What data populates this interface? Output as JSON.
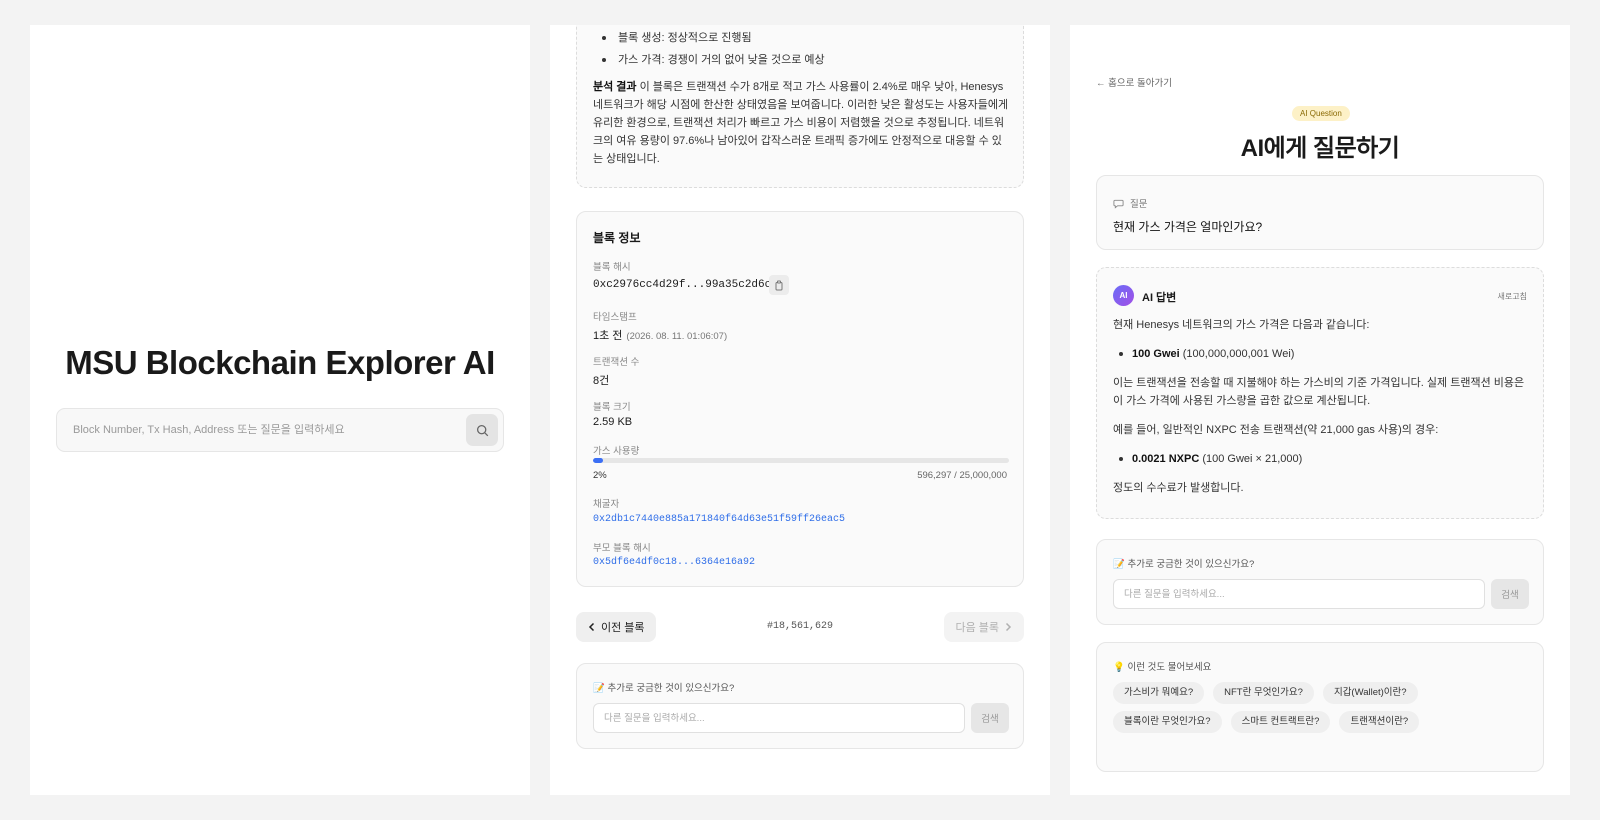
{
  "home": {
    "title": "MSU Blockchain Explorer AI",
    "search_placeholder": "Block Number, Tx Hash, Address 또는 질문을 입력하세요"
  },
  "block_page": {
    "analysis": {
      "bullets": [
        "블록 생성: 정상적으로 진행됨",
        "가스 가격: 경쟁이 거의 없어 낮을 것으로 예상"
      ],
      "result_label": "분석 결과",
      "result_text": " 이 블록은 트랜잭션 수가 8개로 적고 가스 사용률이 2.4%로 매우 낮아, Henesys 네트워크가 해당 시점에 한산한 상태였음을 보여줍니다. 이러한 낮은 활성도는 사용자들에게 유리한 환경으로, 트랜잭션 처리가 빠르고 가스 비용이 저렴했을 것으로 추정됩니다. 네트워크의 여유 용량이 97.6%나 남아있어 갑작스러운 트래픽 증가에도 안정적으로 대응할 수 있는 상태입니다."
    },
    "info": {
      "title": "블록 정보",
      "hash_label": "블록 해시",
      "hash_value": "0xc2976cc4d29f...99a35c2d6c",
      "timestamp_label": "타임스탬프",
      "timestamp_relative": "1초 전",
      "timestamp_absolute": "(2026. 08. 11. 01:06:07)",
      "tx_count_label": "트랜잭션 수",
      "tx_count_value": "8건",
      "size_label": "블록 크기",
      "size_value": "2.59 KB",
      "gas_label": "가스 사용량",
      "gas_percent_text": "2%",
      "gas_fraction": 0.024,
      "gas_detail": "596,297 / 25,000,000",
      "miner_label": "채굴자",
      "miner_value": "0x2db1c7440e885a171840f64d63e51f59ff26eac5",
      "parent_label": "부모 블록 해시",
      "parent_value": "0x5df6e4df0c18...6364e16a92"
    },
    "nav": {
      "prev_label": "이전 블록",
      "block_number": "#18,561,629",
      "next_label": "다음 블록"
    },
    "ask": {
      "label": "📝 추가로 궁금한 것이 있으신가요?",
      "placeholder": "다른 질문을 입력하세요...",
      "button": "검색"
    }
  },
  "ai_page": {
    "back_link": "← 홈으로 돌아가기",
    "badge": "AI Question",
    "title": "AI에게 질문하기",
    "question_label": "질문",
    "question_text": "현재 가스 가격은 얼마인가요?",
    "answer_title": "AI 답변",
    "avatar_text": "AI",
    "refresh_label": "새로고침",
    "answer": {
      "intro": "현재 Henesys 네트워크의 가스 가격은 다음과 같습니다:",
      "b1_bold": "100 Gwei",
      "b1_rest": " (100,000,000,001 Wei)",
      "para2": "이는 트랜잭션을 전송할 때 지불해야 하는 가스비의 기준 가격입니다. 실제 트랜잭션 비용은 이 가스 가격에 사용된 가스량을 곱한 값으로 계산됩니다.",
      "para3": "예를 들어, 일반적인 NXPC 전송 트랜잭션(약 21,000 gas 사용)의 경우:",
      "b2_bold": "0.0021 NXPC",
      "b2_rest": " (100 Gwei × 21,000)",
      "outro": "정도의 수수료가 발생합니다."
    },
    "ask": {
      "label": "📝 추가로 궁금한 것이 있으신가요?",
      "placeholder": "다른 질문을 입력하세요...",
      "button": "검색"
    },
    "suggest_label": "💡 이런 것도 물어보세요",
    "suggestions": [
      "가스비가 뭐예요?",
      "NFT란 무엇인가요?",
      "지갑(Wallet)이란?",
      "블록이란 무엇인가요?",
      "스마트 컨트랙트란?",
      "트랜잭션이란?"
    ]
  },
  "colors": {
    "accent": "#3b6ff5",
    "link": "#2f6ee8",
    "badge_bg": "#fdf1c7"
  },
  "icons": [
    "search-icon",
    "copy-icon",
    "chevron-left-icon",
    "chevron-right-icon",
    "chat-bubble-icon"
  ]
}
